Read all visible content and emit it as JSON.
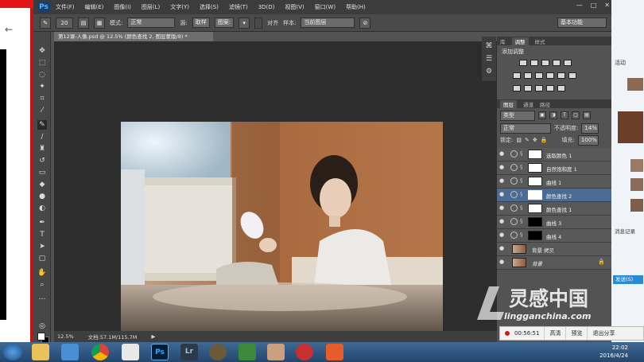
{
  "app": {
    "logo": "Ps",
    "menus": [
      "文件(F)",
      "编辑(E)",
      "图像(I)",
      "图层(L)",
      "文字(Y)",
      "选择(S)",
      "滤镜(T)",
      "3D(D)",
      "视图(V)",
      "窗口(W)",
      "帮助(H)"
    ],
    "window_buttons": [
      "—",
      "□",
      "✕"
    ]
  },
  "options_bar": {
    "brush_size": "20",
    "mode_label": "模式:",
    "mode_value": "正常",
    "source_label": "源:",
    "source_sampled": "取样",
    "source_pattern": "图案:",
    "aligned_label": "对齐",
    "sample_label": "样本:",
    "sample_value": "当前图层",
    "workspace": "基本功能"
  },
  "document": {
    "tab_title": "第12课-人像.psd @ 12.5% (颜色查找 2, 图层蒙版/8) *",
    "zoom": "12.5%",
    "doc_size": "文档:57.1M/115.7M"
  },
  "panels": {
    "top_tabs": [
      "库",
      "调整",
      "样式"
    ],
    "active_top_tab": "调整",
    "adjust_title": "添加调整",
    "layer_tabs": [
      "图层",
      "通道",
      "路径"
    ],
    "filter_kind": "类型",
    "blend_mode": "正常",
    "opacity_label": "不透明度:",
    "opacity_value": "14%",
    "lock_label": "锁定:",
    "fill_label": "填充:",
    "fill_value": "100%",
    "layers": [
      {
        "name": "选取颜色 1",
        "thumb": "white",
        "selected": false
      },
      {
        "name": "自然饱和度 1",
        "thumb": "white",
        "selected": false
      },
      {
        "name": "曲线 1",
        "thumb": "white",
        "selected": false
      },
      {
        "name": "颜色查找 2",
        "thumb": "white",
        "selected": true
      },
      {
        "name": "颜色查找 1",
        "thumb": "white",
        "selected": false
      },
      {
        "name": "曲线 3",
        "thumb": "black",
        "selected": false
      },
      {
        "name": "曲线 4",
        "thumb": "black",
        "selected": false
      },
      {
        "name": "背景 拷贝",
        "thumb": "photo",
        "selected": false
      },
      {
        "name": "背景",
        "thumb": "photo",
        "selected": false
      }
    ]
  },
  "recording": {
    "time": "00:56:51",
    "hd": "高清",
    "preview": "预览",
    "exit_share": "退出分享"
  },
  "watermark": {
    "text": "灵感中国",
    "url": "lingganchina.com"
  },
  "right_window": {
    "items": [
      "活动",
      "消息记录",
      "发送(S)"
    ]
  },
  "taskbar": {
    "time": "22:02",
    "date": "2016/4/24",
    "lr_label": "Lr",
    "ps_label": "Ps"
  },
  "colors": {
    "ps_bg": "#535353",
    "canvas_bg": "#2d2d2d",
    "selected_layer": "#4a6b93",
    "taskbar": "#2d5380"
  }
}
